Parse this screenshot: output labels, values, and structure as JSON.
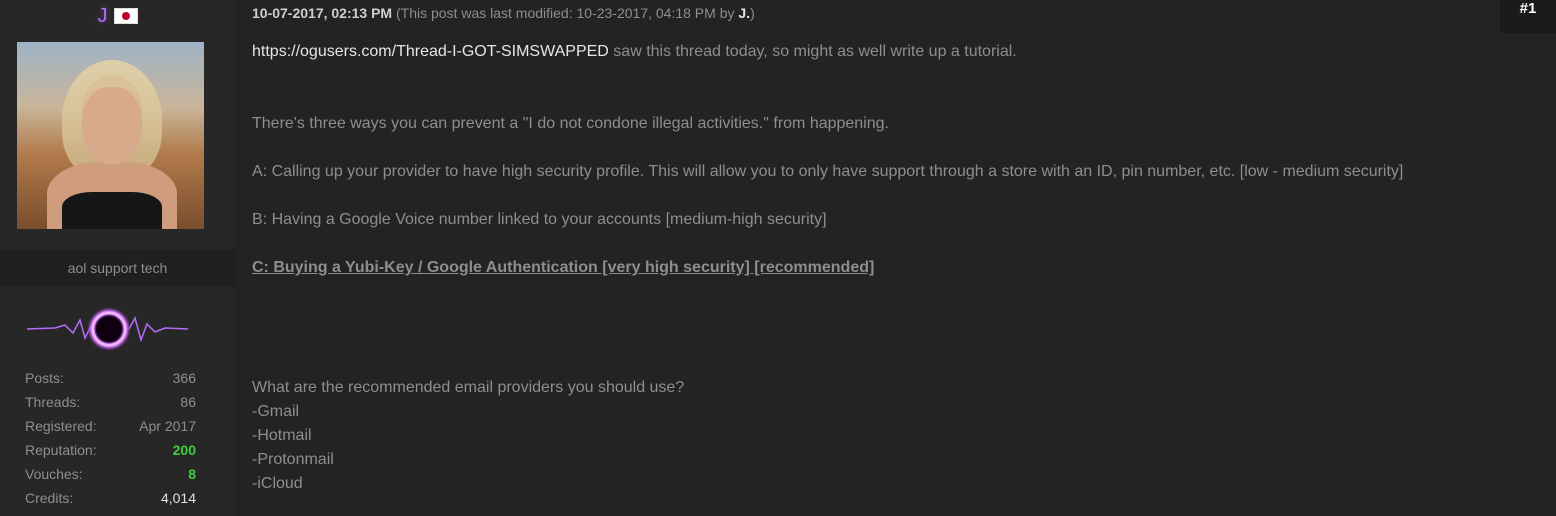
{
  "user": {
    "name": "J",
    "flag": "japan-flag",
    "title": "aol support tech",
    "stats": [
      {
        "label": "Posts:",
        "value": "366",
        "style": "normal"
      },
      {
        "label": "Threads:",
        "value": "86",
        "style": "normal"
      },
      {
        "label": "Registered:",
        "value": "Apr 2017",
        "style": "normal"
      },
      {
        "label": "Reputation:",
        "value": "200",
        "style": "green"
      },
      {
        "label": "Vouches:",
        "value": "8",
        "style": "green"
      },
      {
        "label": "Credits:",
        "value": "4,014",
        "style": "white"
      }
    ]
  },
  "post": {
    "date": "10-07-2017, 02:13 PM",
    "modified_prefix": "(This post was last modified: 10-23-2017, 04:18 PM by ",
    "modified_by": "J.",
    "modified_suffix": ")",
    "number": "#1",
    "link_text": "https://ogusers.com/Thread-I-GOT-SIMSWAPPED",
    "intro_rest": " saw this thread today, so might as well write up a tutorial.",
    "line_ways": "There's three ways you can prevent a \"I do not condone illegal activities.\" from happening.",
    "option_a": "A: Calling up your provider to have high security profile. This will allow you to only have support through a store with an ID, pin number, etc. [low - medium security]",
    "option_b": "B: Having a Google Voice number linked to your accounts [medium-high security]",
    "option_c": "C: Buying a Yubi-Key / Google Authentication [very high security] [recommended]",
    "email_question": "What are the recommended email providers you should use?",
    "providers": [
      "-Gmail",
      "-Hotmail",
      "-Protonmail",
      "-iCloud"
    ]
  },
  "colors": {
    "background": "#232323",
    "sidebar": "#272727",
    "username": "#b06bff",
    "green": "#3ecf3e"
  }
}
